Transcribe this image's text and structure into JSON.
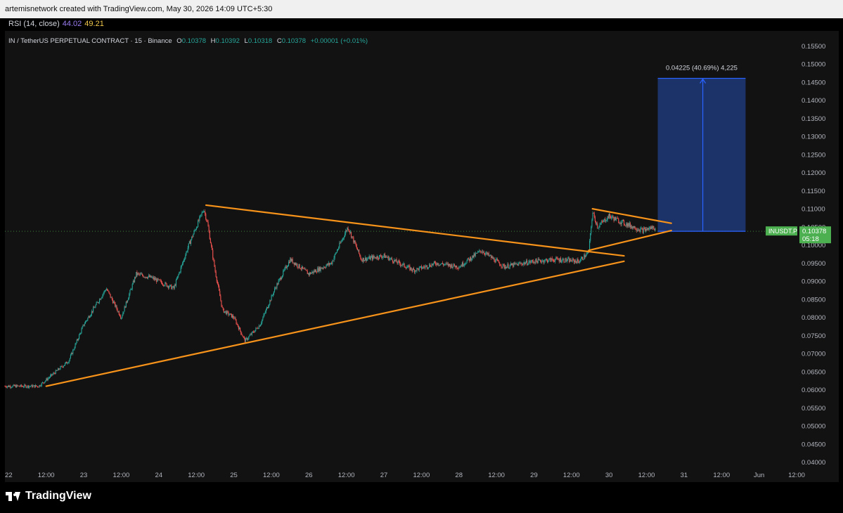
{
  "header": {
    "credit": "artemisnetwork created with TradingView.com, May 30, 2026 14:09 UTC+5:30"
  },
  "indicator": {
    "label": "RSI (14, close)",
    "value1": "44.02",
    "value2": "49.21"
  },
  "symbol_legend": {
    "name": "IN / TetherUS PERPETUAL CONTRACT · 15 · Binance",
    "o_label": "O",
    "o_value": "0.10378",
    "h_label": "H",
    "h_value": "0.10392",
    "l_label": "L",
    "l_value": "0.10318",
    "c_label": "C",
    "c_value": "0.10378",
    "change": "+0.00001 (+0.01%)"
  },
  "price_tag": {
    "symbol": "INUSDT.P",
    "price": "0.10378",
    "countdown": "05:18"
  },
  "measure_label": "0.04225 (40.69%) 4,225",
  "branding": {
    "logo_text": "TradingView"
  },
  "colors": {
    "up": "#26a69a",
    "down": "#ef5350",
    "trendline": "#f7931a",
    "measure_fill": "#1f3a7a",
    "measure_line": "#2962ff",
    "price_tag": "#4caf50"
  },
  "chart_data": {
    "type": "candlestick",
    "y_ticks": [
      "0.15500",
      "0.15000",
      "0.14500",
      "0.14000",
      "0.13500",
      "0.13000",
      "0.12500",
      "0.12000",
      "0.11500",
      "0.11000",
      "0.10500",
      "0.10000",
      "0.09500",
      "0.09000",
      "0.08500",
      "0.08000",
      "0.07500",
      "0.07000",
      "0.06500",
      "0.06000",
      "0.05500",
      "0.05000",
      "0.04500",
      "0.04000"
    ],
    "ylim": [
      0.038,
      0.157
    ],
    "x_ticks": [
      "22",
      "12:00",
      "23",
      "12:00",
      "24",
      "12:00",
      "25",
      "12:00",
      "26",
      "12:00",
      "27",
      "12:00",
      "28",
      "12:00",
      "29",
      "12:00",
      "30",
      "12:00",
      "31",
      "12:00",
      "Jun",
      "12:00"
    ],
    "x_range_days": [
      21.95,
      32.5
    ],
    "price_path": [
      [
        21.95,
        0.061
      ],
      [
        22.4,
        0.061
      ],
      [
        22.8,
        0.068
      ],
      [
        23.0,
        0.078
      ],
      [
        23.3,
        0.088
      ],
      [
        23.5,
        0.08
      ],
      [
        23.7,
        0.092
      ],
      [
        23.9,
        0.091
      ],
      [
        24.2,
        0.088
      ],
      [
        24.4,
        0.1
      ],
      [
        24.6,
        0.11
      ],
      [
        24.65,
        0.106
      ],
      [
        24.75,
        0.093
      ],
      [
        24.85,
        0.082
      ],
      [
        25.0,
        0.08
      ],
      [
        25.15,
        0.0735
      ],
      [
        25.35,
        0.078
      ],
      [
        25.55,
        0.088
      ],
      [
        25.75,
        0.096
      ],
      [
        26.0,
        0.092
      ],
      [
        26.3,
        0.095
      ],
      [
        26.52,
        0.105
      ],
      [
        26.7,
        0.096
      ],
      [
        27.0,
        0.097
      ],
      [
        27.4,
        0.093
      ],
      [
        27.7,
        0.095
      ],
      [
        28.0,
        0.094
      ],
      [
        28.3,
        0.0985
      ],
      [
        28.6,
        0.094
      ],
      [
        29.0,
        0.0955
      ],
      [
        29.3,
        0.096
      ],
      [
        29.6,
        0.0955
      ],
      [
        29.73,
        0.098
      ],
      [
        29.78,
        0.109
      ],
      [
        29.85,
        0.105
      ],
      [
        30.0,
        0.108
      ],
      [
        30.2,
        0.106
      ],
      [
        30.45,
        0.104
      ],
      [
        30.6,
        0.105
      ],
      [
        30.62,
        0.10378
      ]
    ],
    "trendlines": [
      {
        "name": "upper-resistance",
        "from": [
          24.63,
          0.111
        ],
        "to": [
          30.2,
          0.097
        ]
      },
      {
        "name": "lower-support",
        "from": [
          22.5,
          0.061
        ],
        "to": [
          30.2,
          0.0955
        ]
      },
      {
        "name": "pennant-top",
        "from": [
          29.78,
          0.11
        ],
        "to": [
          30.83,
          0.106
        ]
      },
      {
        "name": "pennant-bottom",
        "from": [
          29.73,
          0.0985
        ],
        "to": [
          30.83,
          0.104
        ]
      }
    ],
    "measure": {
      "start_day": 30.65,
      "end_day": 31.82,
      "arrow_day": 31.25,
      "from_price": 0.10378,
      "to_price": 0.14603
    },
    "current_price": 0.10378
  }
}
